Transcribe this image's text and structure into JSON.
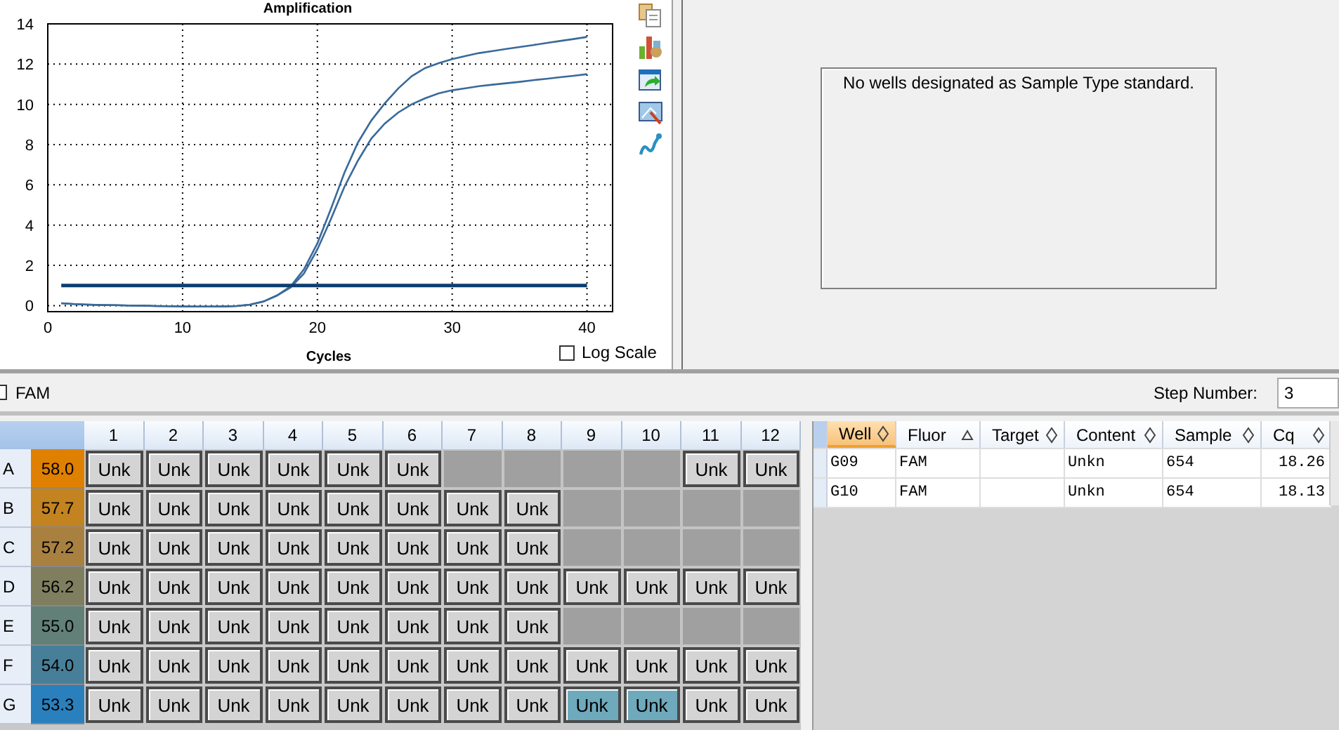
{
  "chart": {
    "log_scale": {
      "label": "Log Scale",
      "checked": false
    },
    "chart_data": {
      "type": "line",
      "grid": true,
      "title": "Amplification",
      "xlabel": "Cycles",
      "xlim": [
        0,
        41.9
      ],
      "ylim": [
        -0.3,
        14
      ],
      "xticks": [
        0,
        10,
        20,
        30,
        40
      ],
      "yticks": [
        0,
        2,
        4,
        6,
        8,
        10,
        12,
        14
      ],
      "x": [
        1,
        2,
        3,
        4,
        5,
        6,
        7,
        8,
        9,
        10,
        11,
        12,
        13,
        14,
        15,
        16,
        17,
        18,
        19,
        20,
        21,
        22,
        23,
        24,
        25,
        26,
        27,
        28,
        29,
        30,
        31,
        32,
        33,
        34,
        35,
        36,
        37,
        38,
        39,
        40
      ],
      "series": [
        {
          "color": "#3a6a9a",
          "values": [
            0.12,
            0.08,
            0.05,
            0.03,
            0.02,
            0.01,
            0,
            -0.02,
            -0.03,
            -0.04,
            -0.05,
            -0.05,
            -0.04,
            -0.02,
            0.05,
            0.2,
            0.5,
            0.95,
            1.8,
            3.1,
            4.8,
            6.6,
            8.1,
            9.2,
            10.05,
            10.8,
            11.4,
            11.8,
            12.05,
            12.25,
            12.4,
            12.55,
            12.65,
            12.75,
            12.85,
            12.95,
            13.05,
            13.15,
            13.25,
            13.35
          ]
        },
        {
          "color": "#3a6a9a",
          "values": [
            0.12,
            0.08,
            0.05,
            0.03,
            0.02,
            0.01,
            0,
            -0.02,
            -0.03,
            -0.04,
            -0.05,
            -0.05,
            -0.04,
            -0.02,
            0.05,
            0.2,
            0.5,
            0.9,
            1.6,
            2.8,
            4.3,
            5.9,
            7.2,
            8.3,
            9.05,
            9.6,
            10.0,
            10.3,
            10.55,
            10.7,
            10.8,
            10.9,
            10.98,
            11.05,
            11.12,
            11.2,
            11.27,
            11.35,
            11.42,
            11.5
          ]
        },
        {
          "color": "#0b3d6e",
          "values": [
            1,
            1,
            1,
            1,
            1,
            1,
            1,
            1,
            1,
            1,
            1,
            1,
            1,
            1,
            1,
            1,
            1,
            1,
            1,
            1,
            1,
            1,
            1,
            1,
            1,
            1,
            1,
            1,
            1,
            1,
            1,
            1,
            1,
            1,
            1,
            1,
            1,
            1,
            1,
            1
          ]
        }
      ]
    }
  },
  "standard_curve": {
    "message": "No wells designated as Sample Type standard."
  },
  "fluor_filter": {
    "label": "FAM",
    "checked": false
  },
  "step_number": {
    "label": "Step Number:",
    "value": "3"
  },
  "plate": {
    "columns": [
      "1",
      "2",
      "3",
      "4",
      "5",
      "6",
      "7",
      "8",
      "9",
      "10",
      "11",
      "12"
    ],
    "rows": [
      {
        "label": "A",
        "temperature": "58.0",
        "color": "#e08000",
        "cells": [
          {
            "kind": "well",
            "label": "Unk",
            "selected": false
          },
          {
            "kind": "well",
            "label": "Unk",
            "selected": false
          },
          {
            "kind": "well",
            "label": "Unk",
            "selected": false
          },
          {
            "kind": "well",
            "label": "Unk",
            "selected": false
          },
          {
            "kind": "well",
            "label": "Unk",
            "selected": false
          },
          {
            "kind": "well",
            "label": "Unk",
            "selected": false
          },
          {
            "kind": "empty"
          },
          {
            "kind": "empty"
          },
          {
            "kind": "empty"
          },
          {
            "kind": "empty"
          },
          {
            "kind": "well",
            "label": "Unk",
            "selected": false
          },
          {
            "kind": "well",
            "label": "Unk",
            "selected": false
          }
        ]
      },
      {
        "label": "B",
        "temperature": "57.7",
        "color": "#c28320",
        "cells": [
          {
            "kind": "well",
            "label": "Unk",
            "selected": false
          },
          {
            "kind": "well",
            "label": "Unk",
            "selected": false
          },
          {
            "kind": "well",
            "label": "Unk",
            "selected": false
          },
          {
            "kind": "well",
            "label": "Unk",
            "selected": false
          },
          {
            "kind": "well",
            "label": "Unk",
            "selected": false
          },
          {
            "kind": "well",
            "label": "Unk",
            "selected": false
          },
          {
            "kind": "well",
            "label": "Unk",
            "selected": false
          },
          {
            "kind": "well",
            "label": "Unk",
            "selected": false
          },
          {
            "kind": "empty"
          },
          {
            "kind": "empty"
          },
          {
            "kind": "empty"
          },
          {
            "kind": "empty"
          }
        ]
      },
      {
        "label": "C",
        "temperature": "57.2",
        "color": "#a88040",
        "cells": [
          {
            "kind": "well",
            "label": "Unk",
            "selected": false
          },
          {
            "kind": "well",
            "label": "Unk",
            "selected": false
          },
          {
            "kind": "well",
            "label": "Unk",
            "selected": false
          },
          {
            "kind": "well",
            "label": "Unk",
            "selected": false
          },
          {
            "kind": "well",
            "label": "Unk",
            "selected": false
          },
          {
            "kind": "well",
            "label": "Unk",
            "selected": false
          },
          {
            "kind": "well",
            "label": "Unk",
            "selected": false
          },
          {
            "kind": "well",
            "label": "Unk",
            "selected": false
          },
          {
            "kind": "empty"
          },
          {
            "kind": "empty"
          },
          {
            "kind": "empty"
          },
          {
            "kind": "empty"
          }
        ]
      },
      {
        "label": "D",
        "temperature": "56.2",
        "color": "#7f7f60",
        "cells": [
          {
            "kind": "well",
            "label": "Unk",
            "selected": false
          },
          {
            "kind": "well",
            "label": "Unk",
            "selected": false
          },
          {
            "kind": "well",
            "label": "Unk",
            "selected": false
          },
          {
            "kind": "well",
            "label": "Unk",
            "selected": false
          },
          {
            "kind": "well",
            "label": "Unk",
            "selected": false
          },
          {
            "kind": "well",
            "label": "Unk",
            "selected": false
          },
          {
            "kind": "well",
            "label": "Unk",
            "selected": false
          },
          {
            "kind": "well",
            "label": "Unk",
            "selected": false
          },
          {
            "kind": "well",
            "label": "Unk",
            "selected": false
          },
          {
            "kind": "well",
            "label": "Unk",
            "selected": false
          },
          {
            "kind": "well",
            "label": "Unk",
            "selected": false
          },
          {
            "kind": "well",
            "label": "Unk",
            "selected": false
          }
        ]
      },
      {
        "label": "E",
        "temperature": "55.0",
        "color": "#628078",
        "cells": [
          {
            "kind": "well",
            "label": "Unk",
            "selected": false
          },
          {
            "kind": "well",
            "label": "Unk",
            "selected": false
          },
          {
            "kind": "well",
            "label": "Unk",
            "selected": false
          },
          {
            "kind": "well",
            "label": "Unk",
            "selected": false
          },
          {
            "kind": "well",
            "label": "Unk",
            "selected": false
          },
          {
            "kind": "well",
            "label": "Unk",
            "selected": false
          },
          {
            "kind": "well",
            "label": "Unk",
            "selected": false
          },
          {
            "kind": "well",
            "label": "Unk",
            "selected": false
          },
          {
            "kind": "empty"
          },
          {
            "kind": "empty"
          },
          {
            "kind": "empty"
          },
          {
            "kind": "empty"
          }
        ]
      },
      {
        "label": "F",
        "temperature": "54.0",
        "color": "#487f98",
        "cells": [
          {
            "kind": "well",
            "label": "Unk",
            "selected": false
          },
          {
            "kind": "well",
            "label": "Unk",
            "selected": false
          },
          {
            "kind": "well",
            "label": "Unk",
            "selected": false
          },
          {
            "kind": "well",
            "label": "Unk",
            "selected": false
          },
          {
            "kind": "well",
            "label": "Unk",
            "selected": false
          },
          {
            "kind": "well",
            "label": "Unk",
            "selected": false
          },
          {
            "kind": "well",
            "label": "Unk",
            "selected": false
          },
          {
            "kind": "well",
            "label": "Unk",
            "selected": false
          },
          {
            "kind": "well",
            "label": "Unk",
            "selected": false
          },
          {
            "kind": "well",
            "label": "Unk",
            "selected": false
          },
          {
            "kind": "well",
            "label": "Unk",
            "selected": false
          },
          {
            "kind": "well",
            "label": "Unk",
            "selected": false
          }
        ]
      },
      {
        "label": "G",
        "temperature": "53.3",
        "color": "#2a80bd",
        "cells": [
          {
            "kind": "well",
            "label": "Unk",
            "selected": false
          },
          {
            "kind": "well",
            "label": "Unk",
            "selected": false
          },
          {
            "kind": "well",
            "label": "Unk",
            "selected": false
          },
          {
            "kind": "well",
            "label": "Unk",
            "selected": false
          },
          {
            "kind": "well",
            "label": "Unk",
            "selected": false
          },
          {
            "kind": "well",
            "label": "Unk",
            "selected": false
          },
          {
            "kind": "well",
            "label": "Unk",
            "selected": false
          },
          {
            "kind": "well",
            "label": "Unk",
            "selected": false
          },
          {
            "kind": "well",
            "label": "Unk",
            "selected": true
          },
          {
            "kind": "well",
            "label": "Unk",
            "selected": true
          },
          {
            "kind": "well",
            "label": "Unk",
            "selected": false
          },
          {
            "kind": "well",
            "label": "Unk",
            "selected": false
          }
        ]
      }
    ]
  },
  "results_table": {
    "columns": [
      {
        "label": "Well",
        "sorted": false,
        "highlighted": true
      },
      {
        "label": "Fluor",
        "sorted": true,
        "highlighted": false
      },
      {
        "label": "Target",
        "sorted": false,
        "highlighted": false
      },
      {
        "label": "Content",
        "sorted": false,
        "highlighted": false
      },
      {
        "label": "Sample",
        "sorted": false,
        "highlighted": false
      },
      {
        "label": "Cq",
        "sorted": false,
        "highlighted": false
      }
    ],
    "rows": [
      {
        "well": "G09",
        "fluor": "FAM",
        "content": "Unkn",
        "sample": "654",
        "cq": "18.26"
      },
      {
        "well": "G10",
        "fluor": "FAM",
        "content": "Unkn",
        "sample": "654",
        "cq": "18.13"
      }
    ]
  }
}
